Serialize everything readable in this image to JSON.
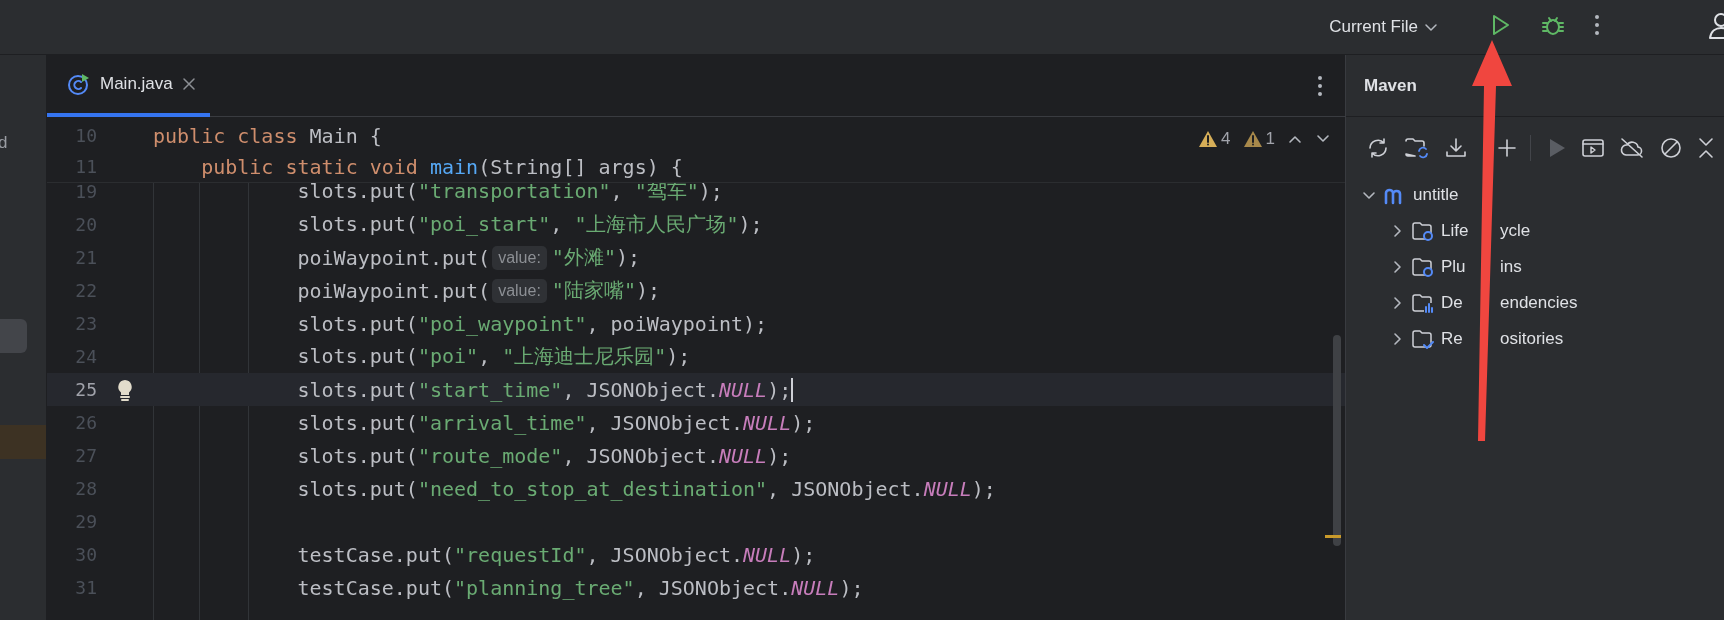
{
  "top_bar": {
    "run_config": "Current File"
  },
  "left_strip": {
    "label": "d"
  },
  "editor": {
    "tabs": [
      {
        "label": "Main.java",
        "selected": true
      }
    ],
    "inspections": [
      {
        "kind": "warning",
        "count": "4"
      },
      {
        "kind": "weak_warning",
        "count": "1"
      }
    ],
    "sticky_lines": [
      {
        "number": "10",
        "tokens": [
          {
            "kind": "keyword",
            "text": "public class "
          },
          {
            "kind": "plain",
            "text": "Main {"
          }
        ]
      },
      {
        "number": "11",
        "tokens": [
          {
            "kind": "keyword",
            "text": "    public static void "
          },
          {
            "kind": "method",
            "text": "main"
          },
          {
            "kind": "plain",
            "text": "(String[] args) {"
          }
        ]
      }
    ],
    "lines": [
      {
        "number": "19",
        "current": false,
        "bulb": false,
        "tokens": [
          {
            "kind": "plain",
            "text": "            slots.put("
          },
          {
            "kind": "string",
            "text": "\"transportation\""
          },
          {
            "kind": "plain",
            "text": ", "
          },
          {
            "kind": "string",
            "text": "\"驾车\""
          },
          {
            "kind": "plain",
            "text": ");"
          }
        ]
      },
      {
        "number": "20",
        "current": false,
        "bulb": false,
        "tokens": [
          {
            "kind": "plain",
            "text": "            slots.put("
          },
          {
            "kind": "string",
            "text": "\"poi_start\""
          },
          {
            "kind": "plain",
            "text": ", "
          },
          {
            "kind": "string",
            "text": "\"上海市人民广场\""
          },
          {
            "kind": "plain",
            "text": ");"
          }
        ]
      },
      {
        "number": "21",
        "current": false,
        "bulb": false,
        "tokens": [
          {
            "kind": "plain",
            "text": "            poiWaypoint.put("
          },
          {
            "kind": "hint",
            "text": "value:"
          },
          {
            "kind": "string",
            "text": "\"外滩\""
          },
          {
            "kind": "plain",
            "text": ");"
          }
        ]
      },
      {
        "number": "22",
        "current": false,
        "bulb": false,
        "tokens": [
          {
            "kind": "plain",
            "text": "            poiWaypoint.put("
          },
          {
            "kind": "hint",
            "text": "value:"
          },
          {
            "kind": "string",
            "text": "\"陆家嘴\""
          },
          {
            "kind": "plain",
            "text": ");"
          }
        ]
      },
      {
        "number": "23",
        "current": false,
        "bulb": false,
        "tokens": [
          {
            "kind": "plain",
            "text": "            slots.put("
          },
          {
            "kind": "string",
            "text": "\"poi_waypoint\""
          },
          {
            "kind": "plain",
            "text": ", poiWaypoint);"
          }
        ]
      },
      {
        "number": "24",
        "current": false,
        "bulb": false,
        "tokens": [
          {
            "kind": "plain",
            "text": "            slots.put("
          },
          {
            "kind": "string",
            "text": "\"poi\""
          },
          {
            "kind": "plain",
            "text": ", "
          },
          {
            "kind": "string",
            "text": "\"上海迪士尼乐园\""
          },
          {
            "kind": "plain",
            "text": ");"
          }
        ]
      },
      {
        "number": "25",
        "current": true,
        "bulb": true,
        "tokens": [
          {
            "kind": "plain",
            "text": "            slots.put("
          },
          {
            "kind": "string",
            "text": "\"start_time\""
          },
          {
            "kind": "plain",
            "text": ", JSONObject."
          },
          {
            "kind": "constant",
            "text": "NULL"
          },
          {
            "kind": "plain",
            "text": ");"
          }
        ]
      },
      {
        "number": "26",
        "current": false,
        "bulb": false,
        "tokens": [
          {
            "kind": "plain",
            "text": "            slots.put("
          },
          {
            "kind": "string",
            "text": "\"arrival_time\""
          },
          {
            "kind": "plain",
            "text": ", JSONObject."
          },
          {
            "kind": "constant",
            "text": "NULL"
          },
          {
            "kind": "plain",
            "text": ");"
          }
        ]
      },
      {
        "number": "27",
        "current": false,
        "bulb": false,
        "tokens": [
          {
            "kind": "plain",
            "text": "            slots.put("
          },
          {
            "kind": "string",
            "text": "\"route_mode\""
          },
          {
            "kind": "plain",
            "text": ", JSONObject."
          },
          {
            "kind": "constant",
            "text": "NULL"
          },
          {
            "kind": "plain",
            "text": ");"
          }
        ]
      },
      {
        "number": "28",
        "current": false,
        "bulb": false,
        "tokens": [
          {
            "kind": "plain",
            "text": "            slots.put("
          },
          {
            "kind": "string",
            "text": "\"need_to_stop_at_destination\""
          },
          {
            "kind": "plain",
            "text": ", JSONObject."
          },
          {
            "kind": "constant",
            "text": "NULL"
          },
          {
            "kind": "plain",
            "text": ");"
          }
        ]
      },
      {
        "number": "29",
        "current": false,
        "bulb": false
      },
      {
        "number": "30",
        "current": false,
        "bulb": false,
        "tokens": [
          {
            "kind": "plain",
            "text": "            testCase.put("
          },
          {
            "kind": "string",
            "text": "\"requestId\""
          },
          {
            "kind": "plain",
            "text": ", JSONObject."
          },
          {
            "kind": "constant",
            "text": "NULL"
          },
          {
            "kind": "plain",
            "text": ");"
          }
        ]
      },
      {
        "number": "31",
        "current": false,
        "bulb": false,
        "tokens": [
          {
            "kind": "plain",
            "text": "            testCase.put("
          },
          {
            "kind": "string",
            "text": "\"planning_tree\""
          },
          {
            "kind": "plain",
            "text": ", JSONObject."
          },
          {
            "kind": "constant",
            "text": "NULL"
          },
          {
            "kind": "plain",
            "text": ");"
          }
        ]
      }
    ]
  },
  "maven": {
    "title": "Maven",
    "tree": [
      {
        "label": "untitle",
        "kind": "project",
        "expanded": true,
        "children": [
          {
            "label_parts": [
              "Life",
              "ycle"
            ],
            "kind": "lifecycle",
            "expanded": false
          },
          {
            "label_parts": [
              "Plu",
              "ins"
            ],
            "kind": "plugins",
            "expanded": false
          },
          {
            "label_parts": [
              "De",
              "endencies"
            ],
            "kind": "dependencies",
            "expanded": false
          },
          {
            "label_parts": [
              "Re",
              "ositories"
            ],
            "kind": "repositories",
            "expanded": false
          }
        ]
      }
    ]
  }
}
